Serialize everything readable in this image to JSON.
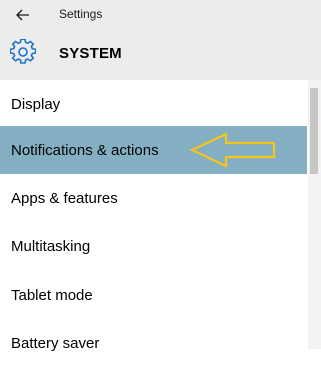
{
  "window": {
    "title": "Settings",
    "back_icon": "back-arrow-icon"
  },
  "section": {
    "title": "SYSTEM",
    "icon": "gear-icon"
  },
  "menu": {
    "items": [
      {
        "label": "Display",
        "selected": false
      },
      {
        "label": "Notifications & actions",
        "selected": true
      },
      {
        "label": "Apps & features",
        "selected": false
      },
      {
        "label": "Multitasking",
        "selected": false
      },
      {
        "label": "Tablet mode",
        "selected": false
      },
      {
        "label": "Battery saver",
        "selected": false
      }
    ]
  },
  "annotation": {
    "type": "arrow-pointing-left",
    "color": "#f5c518"
  },
  "colors": {
    "header_bg": "#ececec",
    "selected_bg": "#84afc3",
    "accent": "#1a73c9"
  }
}
